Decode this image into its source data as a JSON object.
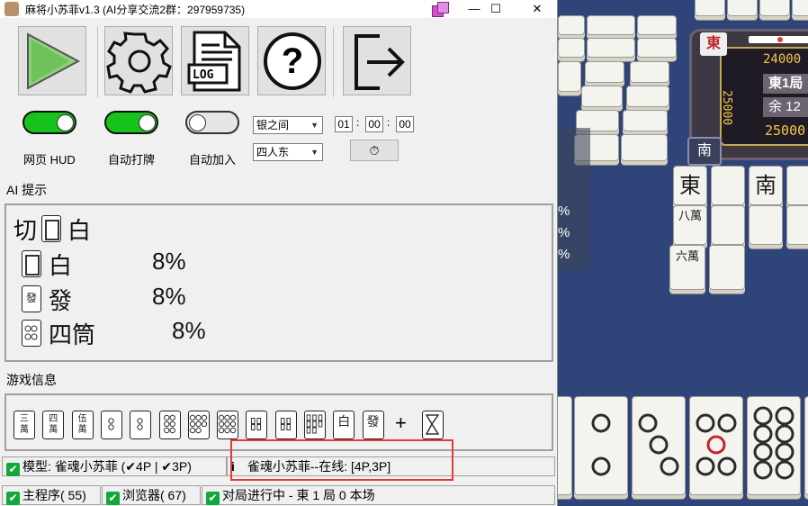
{
  "window": {
    "title": "麻将小苏菲v1.3 (AI分享交流2群：297959735)",
    "controls": {
      "minimize": "—",
      "maximize": "☐",
      "close": "✕"
    }
  },
  "toolbar": {
    "play_label": "",
    "log_label": "LOG",
    "help_label": "?"
  },
  "toggles": [
    {
      "label": "网页 HUD",
      "on": true
    },
    {
      "label": "自动打牌",
      "on": true
    },
    {
      "label": "自动加入",
      "on": false
    }
  ],
  "selects": {
    "room": "银之间",
    "mode": "四人东"
  },
  "timer": {
    "h": "01",
    "sep1": ":",
    "m": "00",
    "sep2": ":",
    "s": "00",
    "icon": "⏱"
  },
  "ai_hint": {
    "header": "AI 提示",
    "discard_prefix": "切",
    "discard_tile": "白",
    "options": [
      {
        "name": "白",
        "pct": "8%"
      },
      {
        "name": "發",
        "pct": "8%"
      },
      {
        "name": "四筒",
        "pct": "8%"
      }
    ]
  },
  "game_info": {
    "header": "游戏信息",
    "hand": [
      "三萬",
      "四萬",
      "伍萬",
      "2筒",
      "2筒",
      "6筒",
      "8筒",
      "9筒",
      "4索",
      "4索",
      "8索",
      "白",
      "發"
    ],
    "plus": "+",
    "draw_tile": "1索"
  },
  "status_bar": {
    "model_label": "模型: 雀魂小苏菲 (✔4P | ✔3P)",
    "info_icon": "i",
    "online_label": "雀魂小苏菲--在线: [4P,3P]",
    "main_program": "主程序( 55)",
    "browser": "浏览器( 67)",
    "match_status": "对局进行中 - 東 1 局 0 本场"
  },
  "game_view": {
    "score_top": "24000",
    "score_left": "25000",
    "score_right": "25000",
    "round": "東1局",
    "remaining": "余 12",
    "wind_tile": "南",
    "seat_wind": "東",
    "pct_marks": [
      "%",
      "%",
      "%"
    ],
    "table_tiles": [
      "東",
      "南",
      "八萬",
      "六萬"
    ]
  },
  "colors": {
    "accent_red": "#e53935",
    "toggle_on": "#17c21a",
    "check": "#14a83a"
  }
}
